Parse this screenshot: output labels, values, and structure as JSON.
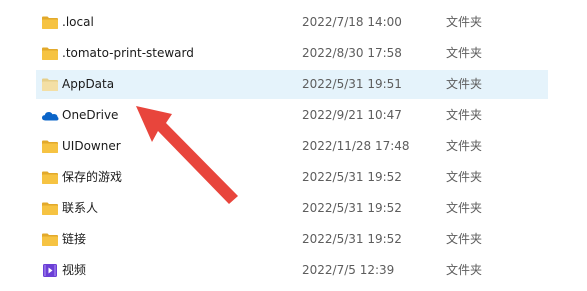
{
  "files": [
    {
      "name": ".local",
      "date": "2022/7/18 14:00",
      "type": "文件夹",
      "icon": "folder-icon"
    },
    {
      "name": ".tomato-print-steward",
      "date": "2022/8/30 17:58",
      "type": "文件夹",
      "icon": "folder-icon"
    },
    {
      "name": "AppData",
      "date": "2022/5/31 19:51",
      "type": "文件夹",
      "icon": "hidden-folder-icon",
      "selected": true
    },
    {
      "name": "OneDrive",
      "date": "2022/9/21 10:47",
      "type": "文件夹",
      "icon": "onedrive-cloud-icon"
    },
    {
      "name": "UIDowner",
      "date": "2022/11/28 17:48",
      "type": "文件夹",
      "icon": "folder-icon"
    },
    {
      "name": "保存的游戏",
      "date": "2022/5/31 19:52",
      "type": "文件夹",
      "icon": "folder-icon"
    },
    {
      "name": "联系人",
      "date": "2022/5/31 19:52",
      "type": "文件夹",
      "icon": "folder-icon"
    },
    {
      "name": "链接",
      "date": "2022/5/31 19:52",
      "type": "文件夹",
      "icon": "folder-icon"
    },
    {
      "name": "视频",
      "date": "2022/7/5 12:39",
      "type": "文件夹",
      "icon": "videos-folder-icon"
    }
  ],
  "colors": {
    "folder": "#f6c342",
    "folder_dark": "#e2a92b",
    "hidden_folder": "#f3dfa5",
    "onedrive": "#0a64c8",
    "videos": "#6b3fd6",
    "selection": "#e5f3fb",
    "arrow": "#e8453c"
  }
}
